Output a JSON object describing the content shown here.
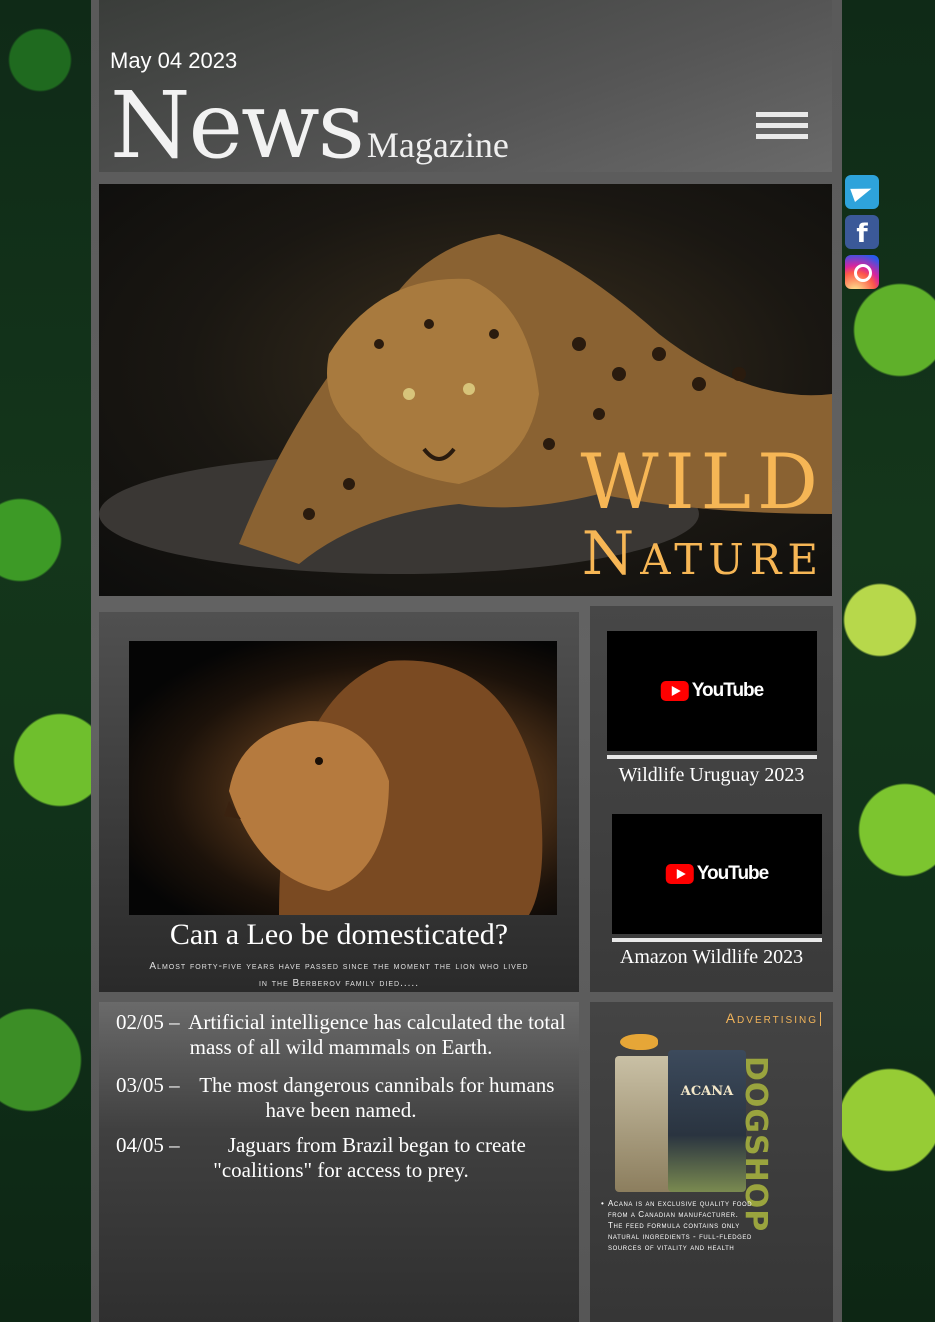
{
  "header": {
    "date": "May 04 2023",
    "brand_news": "News",
    "brand_magazine": "Magazine"
  },
  "hero": {
    "title_line1": "WILD",
    "title_line2": "Nature",
    "image": "leopard-photo"
  },
  "article": {
    "image": "lion-photo",
    "title": "Can a  Leo  be domesticated?",
    "subtitle": "Almost forty-five years have passed since the moment the lion who lived in the Berberov family died....."
  },
  "videos": [
    {
      "logo_text": "YouTube",
      "caption": "Wildlife Uruguay 2023"
    },
    {
      "logo_text": "YouTube",
      "caption": "Amazon Wildlife 2023"
    }
  ],
  "news": [
    {
      "date": "02/05 –",
      "text": "Artificial intelligence has calculated the total mass of all wild mammals on Earth."
    },
    {
      "date": "03/05 –",
      "text": "The most dangerous cannibals for humans have been named."
    },
    {
      "date": "04/05 –",
      "text": "Jaguars from Brazil began to create \"coalitions\" for access to prey."
    }
  ],
  "ad": {
    "label": "Advertising",
    "brand": "DOGSHOP",
    "product": "ACANA",
    "text": "Acana is an exclusive quality food from a Canadian manufacturer. The feed formula contains only natural ingredients - full-fledged sources of vitality and health"
  },
  "social": {
    "icons": [
      "telegram-icon",
      "facebook-icon",
      "instagram-icon"
    ],
    "facebook_glyph": "f"
  },
  "colors": {
    "accent": "#f6b655",
    "youtube_red": "#ff0000",
    "dogshop_green": "#9aa43e"
  }
}
